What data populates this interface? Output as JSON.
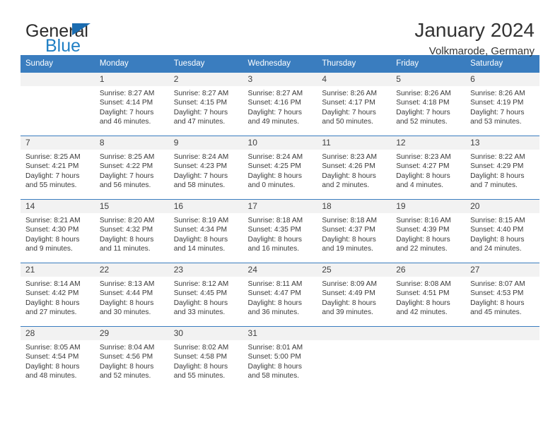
{
  "brand": {
    "name_part1": "General",
    "name_part2": "Blue"
  },
  "header": {
    "title": "January 2024",
    "subtitle": "Volkmarode, Germany"
  },
  "colors": {
    "header_blue": "#3a7dbf",
    "logo_blue": "#1f7fc4",
    "daynum_bg": "#f2f2f2",
    "text": "#3a3a3a"
  },
  "weekdays": [
    "Sunday",
    "Monday",
    "Tuesday",
    "Wednesday",
    "Thursday",
    "Friday",
    "Saturday"
  ],
  "labels": {
    "sunrise_prefix": "Sunrise:",
    "sunset_prefix": "Sunset:",
    "daylight_prefix": "Daylight:"
  },
  "weeks": [
    [
      {
        "day": "",
        "sunrise": "",
        "sunset": "",
        "daylight_line1": "",
        "daylight_line2": ""
      },
      {
        "day": "1",
        "sunrise": "Sunrise: 8:27 AM",
        "sunset": "Sunset: 4:14 PM",
        "daylight_line1": "Daylight: 7 hours",
        "daylight_line2": "and 46 minutes."
      },
      {
        "day": "2",
        "sunrise": "Sunrise: 8:27 AM",
        "sunset": "Sunset: 4:15 PM",
        "daylight_line1": "Daylight: 7 hours",
        "daylight_line2": "and 47 minutes."
      },
      {
        "day": "3",
        "sunrise": "Sunrise: 8:27 AM",
        "sunset": "Sunset: 4:16 PM",
        "daylight_line1": "Daylight: 7 hours",
        "daylight_line2": "and 49 minutes."
      },
      {
        "day": "4",
        "sunrise": "Sunrise: 8:26 AM",
        "sunset": "Sunset: 4:17 PM",
        "daylight_line1": "Daylight: 7 hours",
        "daylight_line2": "and 50 minutes."
      },
      {
        "day": "5",
        "sunrise": "Sunrise: 8:26 AM",
        "sunset": "Sunset: 4:18 PM",
        "daylight_line1": "Daylight: 7 hours",
        "daylight_line2": "and 52 minutes."
      },
      {
        "day": "6",
        "sunrise": "Sunrise: 8:26 AM",
        "sunset": "Sunset: 4:19 PM",
        "daylight_line1": "Daylight: 7 hours",
        "daylight_line2": "and 53 minutes."
      }
    ],
    [
      {
        "day": "7",
        "sunrise": "Sunrise: 8:25 AM",
        "sunset": "Sunset: 4:21 PM",
        "daylight_line1": "Daylight: 7 hours",
        "daylight_line2": "and 55 minutes."
      },
      {
        "day": "8",
        "sunrise": "Sunrise: 8:25 AM",
        "sunset": "Sunset: 4:22 PM",
        "daylight_line1": "Daylight: 7 hours",
        "daylight_line2": "and 56 minutes."
      },
      {
        "day": "9",
        "sunrise": "Sunrise: 8:24 AM",
        "sunset": "Sunset: 4:23 PM",
        "daylight_line1": "Daylight: 7 hours",
        "daylight_line2": "and 58 minutes."
      },
      {
        "day": "10",
        "sunrise": "Sunrise: 8:24 AM",
        "sunset": "Sunset: 4:25 PM",
        "daylight_line1": "Daylight: 8 hours",
        "daylight_line2": "and 0 minutes."
      },
      {
        "day": "11",
        "sunrise": "Sunrise: 8:23 AM",
        "sunset": "Sunset: 4:26 PM",
        "daylight_line1": "Daylight: 8 hours",
        "daylight_line2": "and 2 minutes."
      },
      {
        "day": "12",
        "sunrise": "Sunrise: 8:23 AM",
        "sunset": "Sunset: 4:27 PM",
        "daylight_line1": "Daylight: 8 hours",
        "daylight_line2": "and 4 minutes."
      },
      {
        "day": "13",
        "sunrise": "Sunrise: 8:22 AM",
        "sunset": "Sunset: 4:29 PM",
        "daylight_line1": "Daylight: 8 hours",
        "daylight_line2": "and 7 minutes."
      }
    ],
    [
      {
        "day": "14",
        "sunrise": "Sunrise: 8:21 AM",
        "sunset": "Sunset: 4:30 PM",
        "daylight_line1": "Daylight: 8 hours",
        "daylight_line2": "and 9 minutes."
      },
      {
        "day": "15",
        "sunrise": "Sunrise: 8:20 AM",
        "sunset": "Sunset: 4:32 PM",
        "daylight_line1": "Daylight: 8 hours",
        "daylight_line2": "and 11 minutes."
      },
      {
        "day": "16",
        "sunrise": "Sunrise: 8:19 AM",
        "sunset": "Sunset: 4:34 PM",
        "daylight_line1": "Daylight: 8 hours",
        "daylight_line2": "and 14 minutes."
      },
      {
        "day": "17",
        "sunrise": "Sunrise: 8:18 AM",
        "sunset": "Sunset: 4:35 PM",
        "daylight_line1": "Daylight: 8 hours",
        "daylight_line2": "and 16 minutes."
      },
      {
        "day": "18",
        "sunrise": "Sunrise: 8:18 AM",
        "sunset": "Sunset: 4:37 PM",
        "daylight_line1": "Daylight: 8 hours",
        "daylight_line2": "and 19 minutes."
      },
      {
        "day": "19",
        "sunrise": "Sunrise: 8:16 AM",
        "sunset": "Sunset: 4:39 PM",
        "daylight_line1": "Daylight: 8 hours",
        "daylight_line2": "and 22 minutes."
      },
      {
        "day": "20",
        "sunrise": "Sunrise: 8:15 AM",
        "sunset": "Sunset: 4:40 PM",
        "daylight_line1": "Daylight: 8 hours",
        "daylight_line2": "and 24 minutes."
      }
    ],
    [
      {
        "day": "21",
        "sunrise": "Sunrise: 8:14 AM",
        "sunset": "Sunset: 4:42 PM",
        "daylight_line1": "Daylight: 8 hours",
        "daylight_line2": "and 27 minutes."
      },
      {
        "day": "22",
        "sunrise": "Sunrise: 8:13 AM",
        "sunset": "Sunset: 4:44 PM",
        "daylight_line1": "Daylight: 8 hours",
        "daylight_line2": "and 30 minutes."
      },
      {
        "day": "23",
        "sunrise": "Sunrise: 8:12 AM",
        "sunset": "Sunset: 4:45 PM",
        "daylight_line1": "Daylight: 8 hours",
        "daylight_line2": "and 33 minutes."
      },
      {
        "day": "24",
        "sunrise": "Sunrise: 8:11 AM",
        "sunset": "Sunset: 4:47 PM",
        "daylight_line1": "Daylight: 8 hours",
        "daylight_line2": "and 36 minutes."
      },
      {
        "day": "25",
        "sunrise": "Sunrise: 8:09 AM",
        "sunset": "Sunset: 4:49 PM",
        "daylight_line1": "Daylight: 8 hours",
        "daylight_line2": "and 39 minutes."
      },
      {
        "day": "26",
        "sunrise": "Sunrise: 8:08 AM",
        "sunset": "Sunset: 4:51 PM",
        "daylight_line1": "Daylight: 8 hours",
        "daylight_line2": "and 42 minutes."
      },
      {
        "day": "27",
        "sunrise": "Sunrise: 8:07 AM",
        "sunset": "Sunset: 4:53 PM",
        "daylight_line1": "Daylight: 8 hours",
        "daylight_line2": "and 45 minutes."
      }
    ],
    [
      {
        "day": "28",
        "sunrise": "Sunrise: 8:05 AM",
        "sunset": "Sunset: 4:54 PM",
        "daylight_line1": "Daylight: 8 hours",
        "daylight_line2": "and 48 minutes."
      },
      {
        "day": "29",
        "sunrise": "Sunrise: 8:04 AM",
        "sunset": "Sunset: 4:56 PM",
        "daylight_line1": "Daylight: 8 hours",
        "daylight_line2": "and 52 minutes."
      },
      {
        "day": "30",
        "sunrise": "Sunrise: 8:02 AM",
        "sunset": "Sunset: 4:58 PM",
        "daylight_line1": "Daylight: 8 hours",
        "daylight_line2": "and 55 minutes."
      },
      {
        "day": "31",
        "sunrise": "Sunrise: 8:01 AM",
        "sunset": "Sunset: 5:00 PM",
        "daylight_line1": "Daylight: 8 hours",
        "daylight_line2": "and 58 minutes."
      },
      {
        "day": "",
        "sunrise": "",
        "sunset": "",
        "daylight_line1": "",
        "daylight_line2": ""
      },
      {
        "day": "",
        "sunrise": "",
        "sunset": "",
        "daylight_line1": "",
        "daylight_line2": ""
      },
      {
        "day": "",
        "sunrise": "",
        "sunset": "",
        "daylight_line1": "",
        "daylight_line2": ""
      }
    ]
  ]
}
